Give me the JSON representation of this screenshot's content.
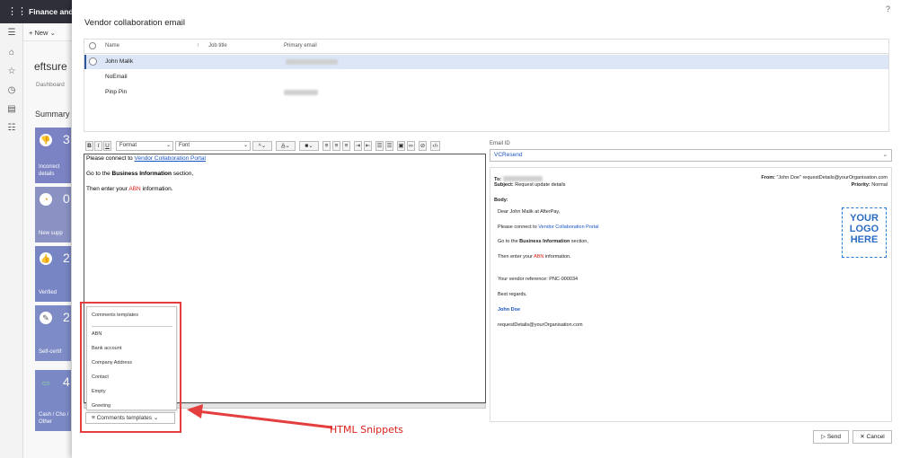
{
  "app": {
    "title": "Finance and",
    "new_label": "New",
    "workspace_title": "eftsure",
    "dashboard_label": "Dashboard",
    "summary_label": "Summary",
    "tiles": [
      {
        "num": "3",
        "label": "Incorrect details",
        "icon": "thumbs-down-icon",
        "color": "#7b83c4"
      },
      {
        "num": "0",
        "label": "New supp",
        "icon": "clock-icon",
        "color": "#8a92c4"
      },
      {
        "num": "2",
        "label": "Verified",
        "icon": "thumbs-up-icon",
        "color": "#7785c4"
      },
      {
        "num": "2",
        "label": "Self-certif",
        "icon": "signature-icon",
        "color": "#7d8bc6"
      },
      {
        "num": "4",
        "label": "Cash / Cho / Other",
        "icon": "cash-icon",
        "color": "#7a88c5"
      }
    ]
  },
  "dialog": {
    "title": "Vendor collaboration email",
    "help": "?",
    "grid": {
      "columns": [
        "Name",
        "Job title",
        "Primary email"
      ],
      "rows": [
        {
          "name": "John  Malik",
          "selected": true
        },
        {
          "name": "NoEmail",
          "selected": false
        },
        {
          "name": "Pinp Pin",
          "selected": false
        }
      ]
    },
    "toolbar": {
      "bold": "B",
      "italic": "I",
      "underline": "U",
      "format": "Format",
      "font": "Font"
    },
    "editor": {
      "line1_prefix": "Please connect to ",
      "line1_link": "Vendor Collaboration Portal",
      "line2_prefix": "Go to the ",
      "line2_bold": "Business Information",
      "line2_suffix": " section,",
      "line3_prefix": "Then enter your ",
      "line3_red": "ABN",
      "line3_suffix": " information."
    },
    "snippets": {
      "header": "Comments templates",
      "items": [
        "ABN",
        "Bank account",
        "Company Address",
        "Contact",
        "Empty",
        "Greeting"
      ],
      "button_label": "Comments templates"
    },
    "annotation": "HTML Snippets",
    "email_id": {
      "label": "Email ID",
      "value": "VCResend"
    },
    "preview": {
      "to_label": "To:",
      "subject_label": "Subject:",
      "subject_value": "Request update details",
      "from_label": "From:",
      "from_value": "\"John Doe\" requestDetails@yourOrganisation.com",
      "priority_label": "Priority:",
      "priority_value": "Normal",
      "body_label": "Body:",
      "greeting": "Dear John Malik at AfterPay,",
      "line1_prefix": "Please connect to ",
      "line1_link": "Vendor Collaboration Portal",
      "line2_prefix": "Go to the ",
      "line2_bold": "Business Information",
      "line2_suffix": " section,",
      "line3_prefix": "Then enter your ",
      "line3_red": "ABN",
      "line3_suffix": " information.",
      "reference": "Your vendor reference: PNC-000034",
      "regards": "Best regards,",
      "signature_name": "John Doe",
      "signature_email": "requestDetails@yourOrganisation.com",
      "logo_lines": [
        "YOUR",
        "LOGO",
        "HERE"
      ]
    },
    "send_label": "Send",
    "cancel_label": "Cancel"
  }
}
